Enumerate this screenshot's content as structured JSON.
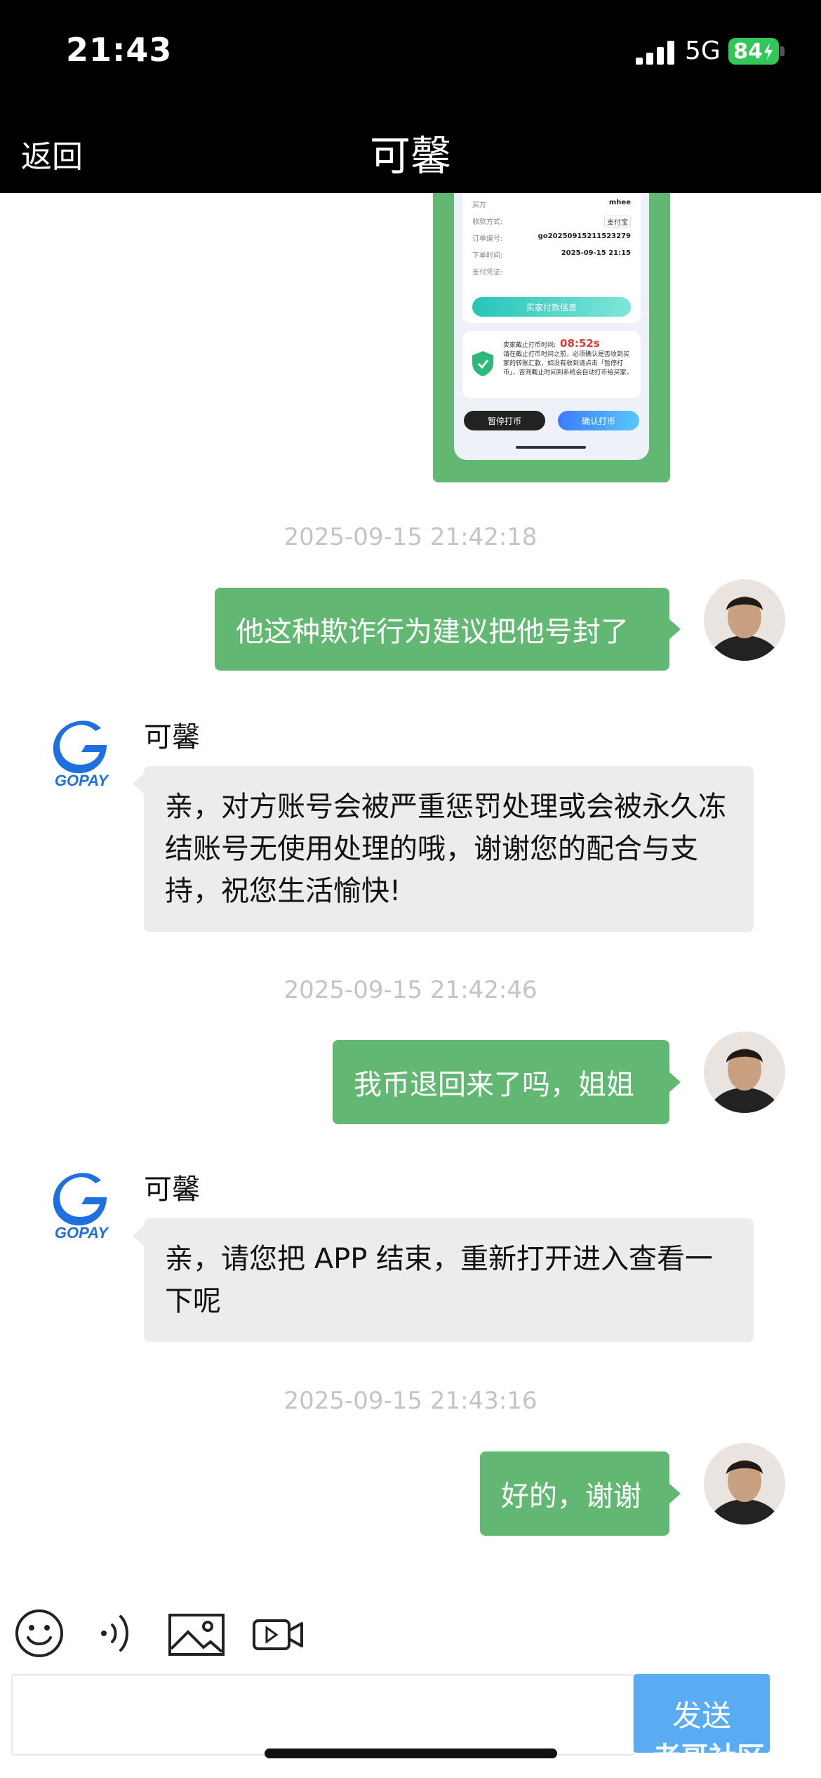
{
  "status_bar": {
    "time": "21:43",
    "network": "5G",
    "battery": "84"
  },
  "header": {
    "back_label": "返回",
    "title": "可馨"
  },
  "screenshot_message": {
    "rows": [
      {
        "label": "买方",
        "value": "mhee"
      },
      {
        "label": "收款方式:",
        "value": "支付宝"
      },
      {
        "label": "订单编号:",
        "value": "go20250915211523279"
      },
      {
        "label": "下单时间:",
        "value": "2025-09-15 21:15"
      },
      {
        "label": "支付凭证:",
        "value": ""
      }
    ],
    "pay_info_button": "买家付款信息",
    "warning_title": "卖家截止打币时间:",
    "countdown": "08:52s",
    "warning_text": "请在截止打币时间之前，必须确认是否收到买家的转账汇款，如没有收到请点击「暂停打币」，否则截止时间到系统会自动打币给买家。",
    "pause_button": "暂停打币",
    "confirm_button": "确认打币"
  },
  "messages": [
    {
      "type": "timestamp",
      "text": "2025-09-15 21:42:18"
    },
    {
      "type": "outgoing",
      "text": "他这种欺诈行为建议把他号封了"
    },
    {
      "type": "incoming",
      "sender": "可馨",
      "text": "亲，对方账号会被严重惩罚处理或会被永久冻结账号无使用处理的哦，谢谢您的配合与支持，祝您生活愉快!"
    },
    {
      "type": "timestamp",
      "text": "2025-09-15 21:42:46"
    },
    {
      "type": "outgoing",
      "text": "我币退回来了吗，姐姐"
    },
    {
      "type": "incoming",
      "sender": "可馨",
      "text": "亲，请您把 APP 结束，重新打开进入查看一下呢"
    },
    {
      "type": "timestamp",
      "text": "2025-09-15 21:43:16"
    },
    {
      "type": "outgoing",
      "text": "好的，谢谢"
    }
  ],
  "agent_logo": "GOPAY",
  "toolbar": {
    "icons": [
      "emoji-icon",
      "voice-icon",
      "image-icon",
      "video-icon"
    ]
  },
  "composer": {
    "placeholder": "",
    "send_label": "发送"
  },
  "watermark": "老哥社区",
  "colors": {
    "outgoing_bubble": "#62b873",
    "incoming_bubble": "#ececec",
    "send_button": "#5aacf2",
    "gopay_blue": "#1e6fe0"
  }
}
